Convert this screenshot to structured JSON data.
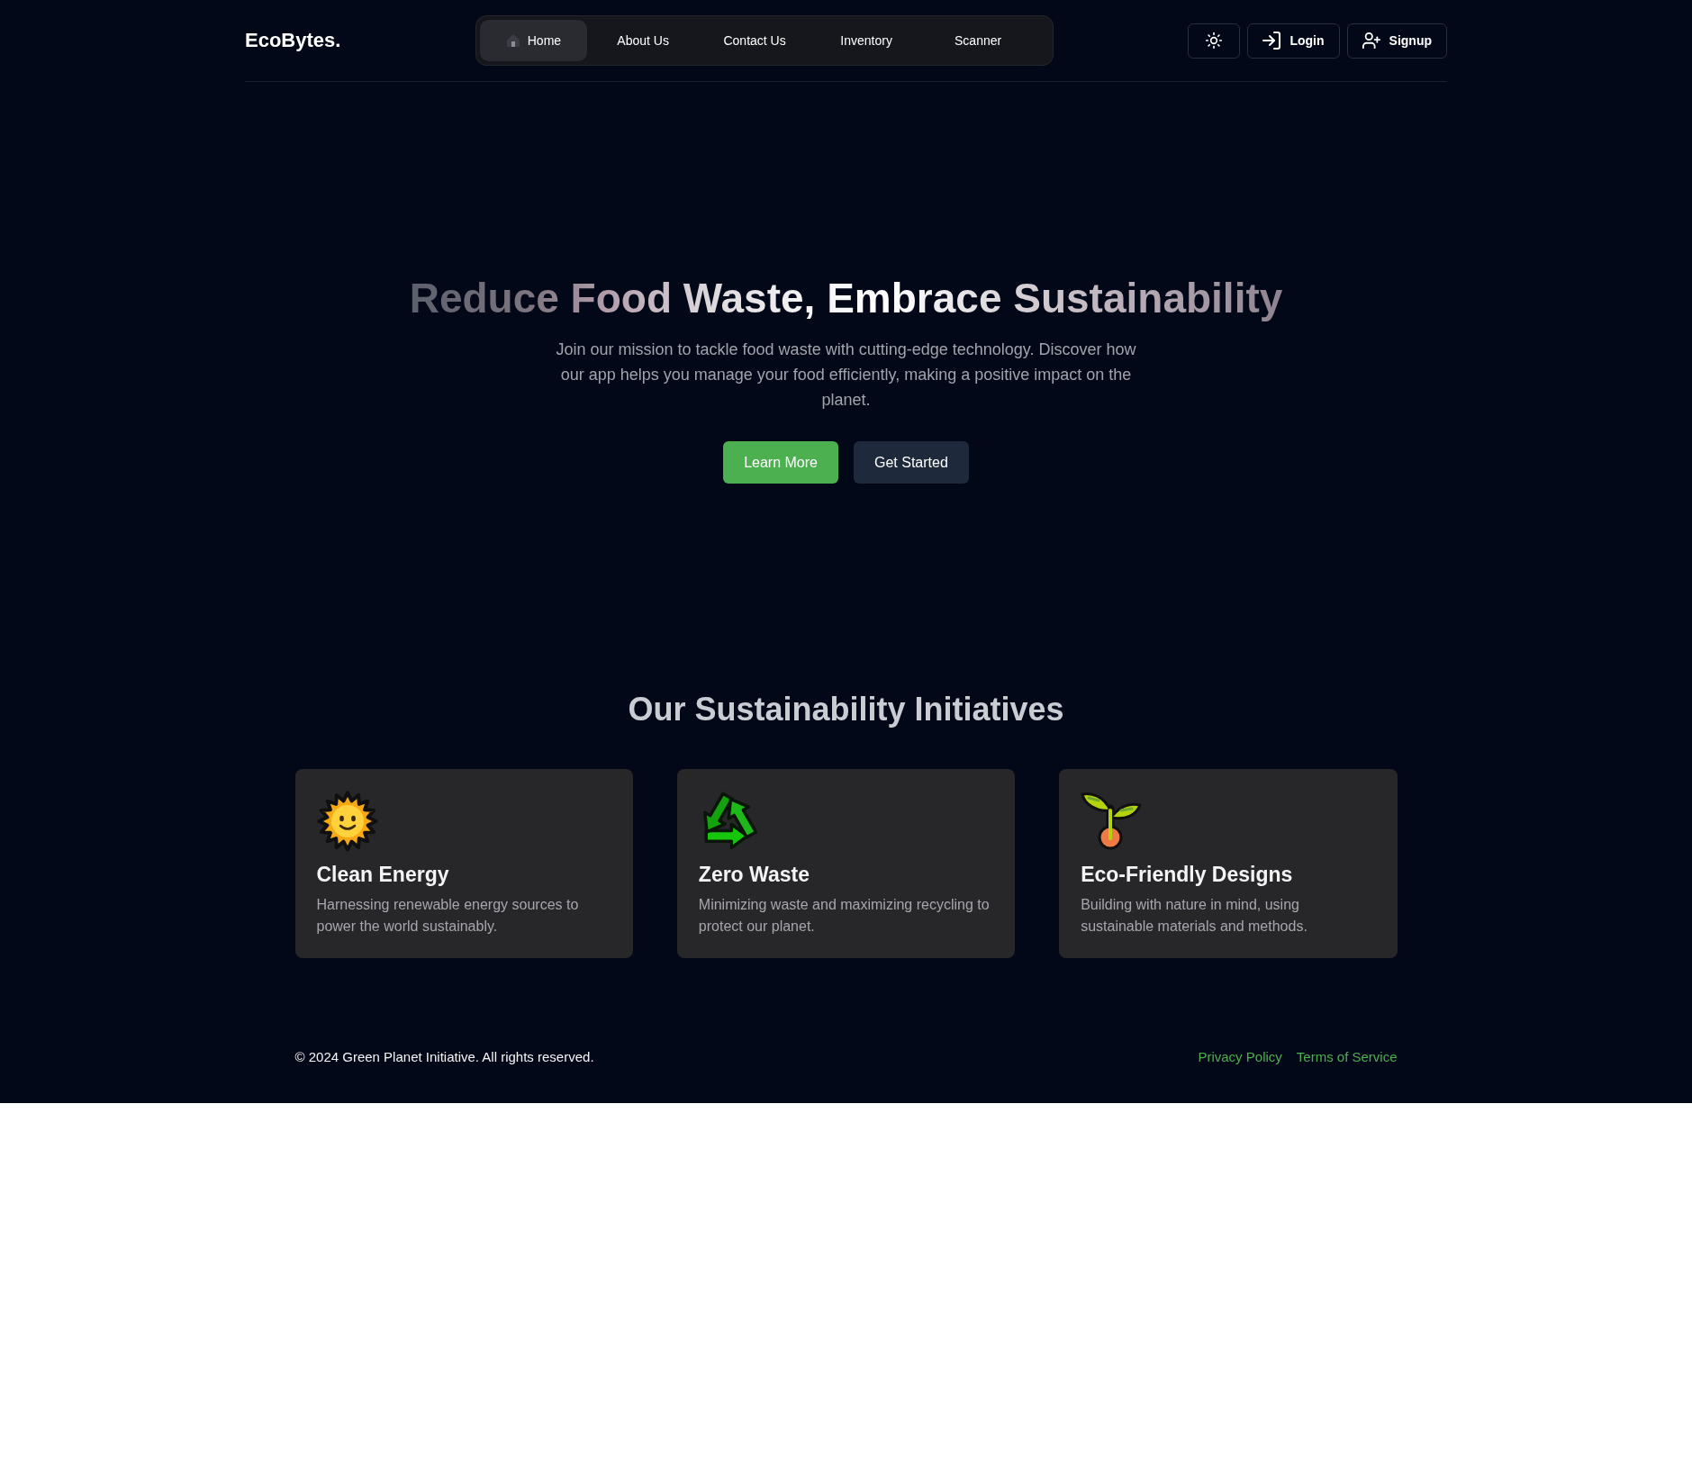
{
  "brand": {
    "name": "EcoBytes."
  },
  "nav": {
    "items": [
      {
        "label": "Home",
        "selected": true,
        "kind": "icon"
      },
      {
        "label": "About Us",
        "selected": false,
        "kind": "text"
      },
      {
        "label": "Contact Us",
        "selected": false,
        "kind": "text"
      },
      {
        "label": "Inventory",
        "selected": false,
        "kind": "text"
      },
      {
        "label": "Scanner",
        "selected": false,
        "kind": "text"
      }
    ]
  },
  "header_actions": [
    {
      "kind": "theme"
    },
    {
      "kind": "login",
      "label": "Login"
    },
    {
      "kind": "signup",
      "label": "Signup"
    }
  ],
  "hero": {
    "title": "Reduce Food Waste, Embrace Sustainability",
    "subtitle": "Join our mission to tackle food waste with cutting-edge technology. Discover how our app helps you manage your food efficiently, making a positive impact on the planet.",
    "buttons": [
      {
        "label": "Learn More",
        "kind": "primary"
      },
      {
        "label": "Get Started",
        "kind": "secondary"
      }
    ]
  },
  "initiatives": {
    "heading": "Our Sustainability Initiatives",
    "cards": [
      {
        "kind": "energy",
        "title": "Clean Energy",
        "text": "Harnessing renewable energy sources to power the world sustainably."
      },
      {
        "kind": "recycling",
        "title": "Zero Waste",
        "text": "Minimizing waste and maximizing recycling to protect our planet."
      },
      {
        "kind": "plant",
        "title": "Eco-Friendly Designs",
        "text": "Building with nature in mind, using sustainable materials and methods."
      }
    ]
  },
  "footer": {
    "copyright": "© 2024 Green Planet Initiative. All rights reserved.",
    "links": [
      "Privacy Policy",
      "Terms of Service"
    ]
  }
}
